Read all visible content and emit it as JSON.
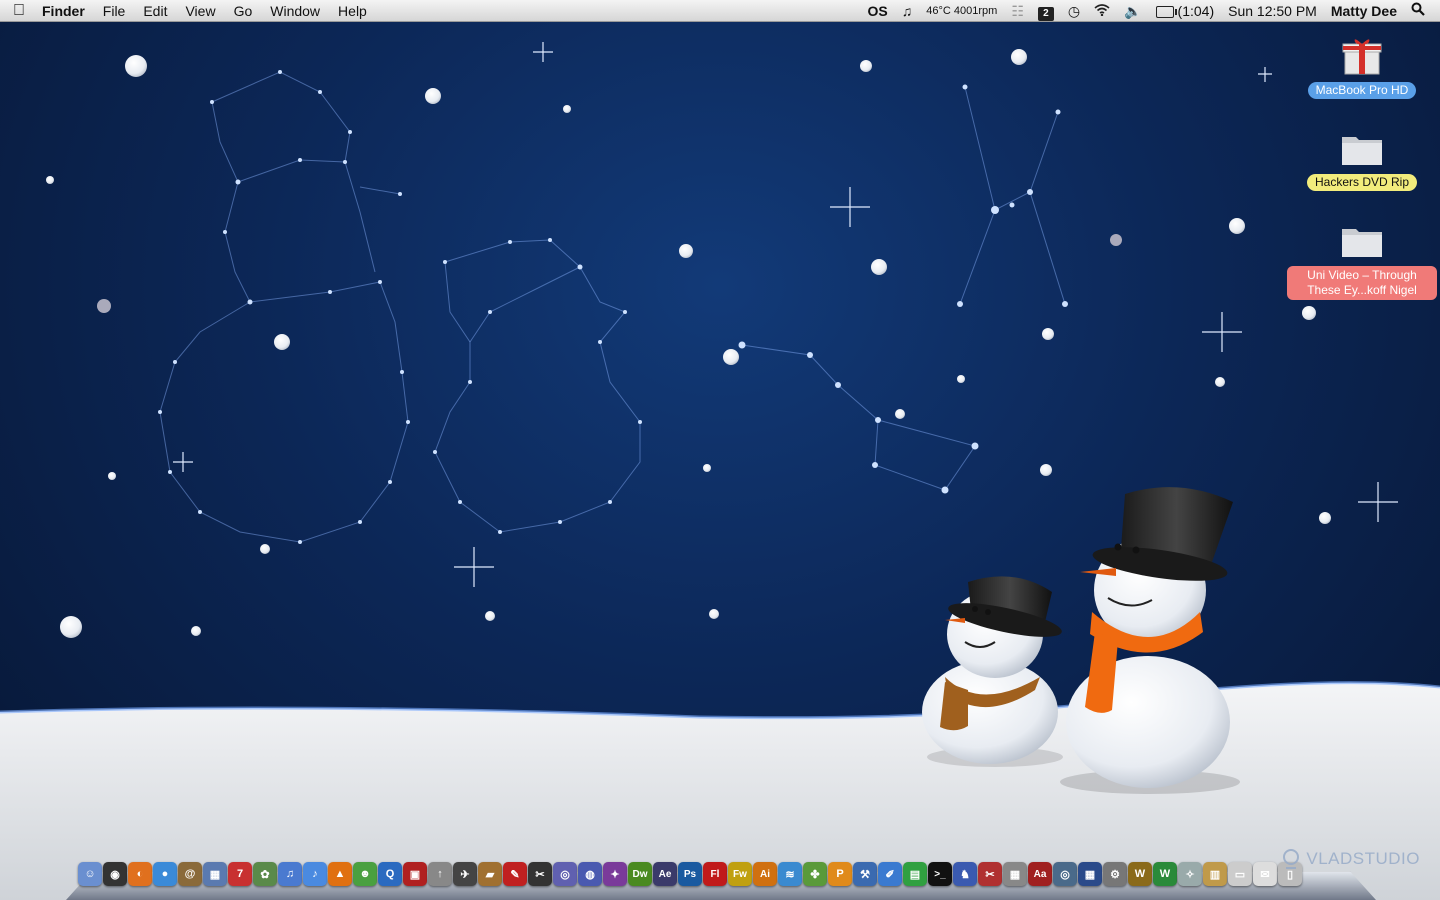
{
  "menubar": {
    "app_name": "Finder",
    "menus": [
      "File",
      "Edit",
      "View",
      "Go",
      "Window",
      "Help"
    ],
    "extras": {
      "os_label": "OS",
      "temp_rpm": "46°C 4001rpm",
      "spaces_number": "2",
      "battery_time": "(1:04)",
      "clock": "Sun 12:50 PM",
      "user": "Matty Dee"
    }
  },
  "desktop_icons": [
    {
      "label": "MacBook Pro HD",
      "icon": "gift-drive-icon",
      "color": "#5aa0e8"
    },
    {
      "label": "Hackers DVD Rip",
      "icon": "folder-icon",
      "color": "#f2ec7c"
    },
    {
      "label": "Uni Video – Through These Ey...koff Nigel",
      "icon": "folder-icon",
      "color": "#f07a78"
    }
  ],
  "dock": {
    "apps": [
      {
        "name": "finder",
        "glyph": "☺",
        "color": "#6a8fd0"
      },
      {
        "name": "dashboard",
        "glyph": "◉",
        "color": "#333"
      },
      {
        "name": "firefox",
        "glyph": "◐",
        "color": "#e0701e"
      },
      {
        "name": "ichat",
        "glyph": "●",
        "color": "#3a8ad8"
      },
      {
        "name": "addressbook",
        "glyph": "@",
        "color": "#8a6a3a"
      },
      {
        "name": "preview",
        "glyph": "▦",
        "color": "#5a7ab0"
      },
      {
        "name": "ical",
        "glyph": "7",
        "color": "#c83030"
      },
      {
        "name": "iphoto",
        "glyph": "✿",
        "color": "#5a8a4a"
      },
      {
        "name": "itunes-install",
        "glyph": "♫",
        "color": "#4a7ad0"
      },
      {
        "name": "itunes",
        "glyph": "♪",
        "color": "#4a8ae0"
      },
      {
        "name": "vlc",
        "glyph": "▲",
        "color": "#e07010"
      },
      {
        "name": "adium",
        "glyph": "☻",
        "color": "#4aa040"
      },
      {
        "name": "quicktime",
        "glyph": "Q",
        "color": "#2a6ac0"
      },
      {
        "name": "photobooth",
        "glyph": "▣",
        "color": "#b02020"
      },
      {
        "name": "flickr-uploadr",
        "glyph": "↑",
        "color": "#888"
      },
      {
        "name": "cyberduck",
        "glyph": "✈",
        "color": "#444"
      },
      {
        "name": "stuffit",
        "glyph": "▰",
        "color": "#a07030"
      },
      {
        "name": "textmate",
        "glyph": "✎",
        "color": "#c02020"
      },
      {
        "name": "fcp",
        "glyph": "✂",
        "color": "#333"
      },
      {
        "name": "dvd-studio",
        "glyph": "◎",
        "color": "#6060b0"
      },
      {
        "name": "motion",
        "glyph": "◍",
        "color": "#4a5ab0"
      },
      {
        "name": "color",
        "glyph": "✦",
        "color": "#7a3a9a"
      },
      {
        "name": "dreamweaver",
        "glyph": "Dw",
        "color": "#4a8a20"
      },
      {
        "name": "after-effects",
        "glyph": "Ae",
        "color": "#3a3a6a"
      },
      {
        "name": "photoshop",
        "glyph": "Ps",
        "color": "#1a5aa0"
      },
      {
        "name": "flash",
        "glyph": "Fl",
        "color": "#c01a1a"
      },
      {
        "name": "fireworks",
        "glyph": "Fw",
        "color": "#c0a010"
      },
      {
        "name": "illustrator",
        "glyph": "Ai",
        "color": "#d07010"
      },
      {
        "name": "soundbooth",
        "glyph": "≋",
        "color": "#3a8ad0"
      },
      {
        "name": "bridge",
        "glyph": "✤",
        "color": "#5a9a3a"
      },
      {
        "name": "pages",
        "glyph": "P",
        "color": "#e08a1a"
      },
      {
        "name": "xcode",
        "glyph": "⚒",
        "color": "#3a6ab0"
      },
      {
        "name": "interface-builder",
        "glyph": "✐",
        "color": "#3a7ad0"
      },
      {
        "name": "activity-monitor",
        "glyph": "▤",
        "color": "#30a040"
      },
      {
        "name": "terminal",
        "glyph": ">_",
        "color": "#111"
      },
      {
        "name": "automator",
        "glyph": "♞",
        "color": "#3a5ab0"
      },
      {
        "name": "script-editor",
        "glyph": "✂",
        "color": "#b03030"
      },
      {
        "name": "calculator",
        "glyph": "▦",
        "color": "#888"
      },
      {
        "name": "dictionary",
        "glyph": "Aa",
        "color": "#a02020"
      },
      {
        "name": "disk-utility",
        "glyph": "◎",
        "color": "#4a6a8a"
      },
      {
        "name": "expose",
        "glyph": "▦",
        "color": "#2a4a8a"
      },
      {
        "name": "system-prefs",
        "glyph": "⚙",
        "color": "#777"
      },
      {
        "name": "world-of-warcraft",
        "glyph": "W",
        "color": "#8a6a1a"
      },
      {
        "name": "wow-patch",
        "glyph": "W",
        "color": "#2a8a3a"
      },
      {
        "name": "applications-stack",
        "glyph": "✧",
        "color": "#9aa"
      },
      {
        "name": "documents-stack",
        "glyph": "▥",
        "color": "#c09a4a"
      },
      {
        "name": "downloads-stack",
        "glyph": "▭",
        "color": "#ccc"
      },
      {
        "name": "mail-stack",
        "glyph": "✉",
        "color": "#ddd"
      },
      {
        "name": "trash",
        "glyph": "▯",
        "color": "#bbb"
      }
    ]
  },
  "watermark": "VLADSTUDIO"
}
